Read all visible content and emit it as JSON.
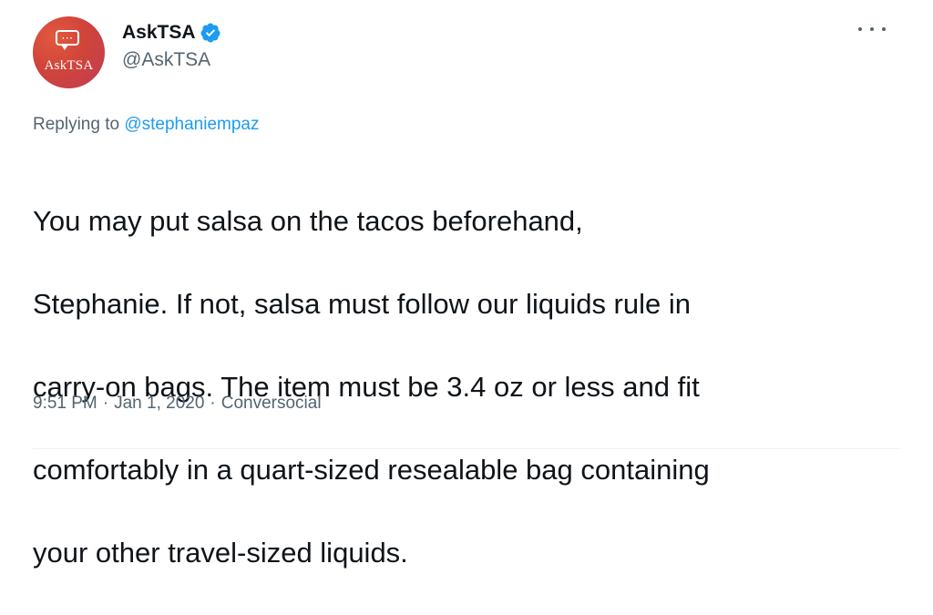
{
  "author": {
    "avatar_text": "AskTSA",
    "display_name": "AskTSA",
    "handle": "@AskTSA",
    "verified": true
  },
  "reply": {
    "prefix": "Replying to",
    "mention": "@stephaniempaz"
  },
  "tweet": {
    "text_lines": [
      "You may put salsa on the tacos beforehand,",
      "Stephanie. If not, salsa must follow our liquids rule in",
      "carry-on bags. The item must be 3.4 oz or less and fit",
      "comfortably in a quart-sized resealable bag containing",
      "your other travel-sized liquids."
    ]
  },
  "meta": {
    "time": "9:51 PM",
    "separator": "·",
    "date": "Jan 1, 2020",
    "source": "Conversocial"
  },
  "icons": {
    "verified": "verified-badge-icon",
    "more": "more-options-icon",
    "avatar_bubble": "chat-bubble-icon"
  },
  "colors": {
    "accent": "#1d9bf0",
    "secondary_text": "#536471",
    "primary_text": "#0f1419",
    "avatar": "#d0443a"
  }
}
